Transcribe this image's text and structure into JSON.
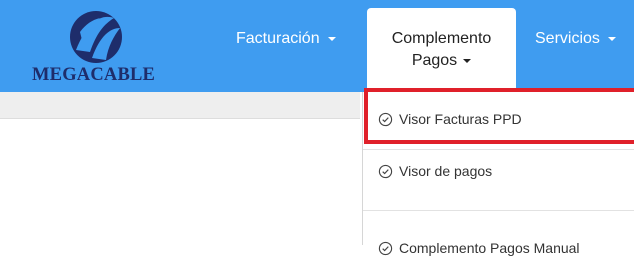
{
  "brand": {
    "name": "MEGACABLE",
    "logo_color": "#1e2d6b",
    "navbar_color": "#3f9cf0"
  },
  "nav": {
    "facturacion": "Facturación",
    "complemento_line1": "Complemento",
    "complemento_line2": "Pagos",
    "servicios": "Servicios"
  },
  "dropdown": {
    "items": [
      {
        "label": "Visor Facturas PPD",
        "icon": "check-circle-icon",
        "highlighted": true,
        "highlight_color": "#e0202a"
      },
      {
        "label": "Visor de pagos",
        "icon": "check-circle-icon"
      },
      {
        "label": "Complemento Pagos Manual",
        "icon": "check-circle-icon"
      }
    ]
  }
}
